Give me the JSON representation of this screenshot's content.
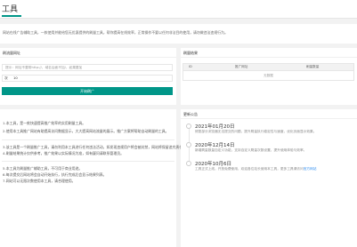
{
  "app": {
    "title": "工具"
  },
  "intro": "网站在线广告辅助工具，一款使用并能给您无优惠提供的刷量工具，帮你提高在线效率，正常操作不要以任何非法目的使用，请勿做违法违规行为。",
  "form": {
    "card_title": "刷流量网址",
    "url_placeholder": "提示：网址不要带http://，域名后面不加/，如果要加",
    "count_prefix": "次",
    "count_value": "10",
    "submit_label": "开始刷广"
  },
  "results": {
    "card_title": "刷量结果",
    "columns": [
      "ID",
      "推广网址",
      "刷量数量"
    ],
    "empty_text": "无数据"
  },
  "tips": [
    "1.本工具，是一款快速提高推广效率的实用刷量工具。",
    "2.使用本工具推广网站有助提高访问数据显示，大大提高网站流量的展示。推广方案将帮助自动刷量的工具。",
    "3.该工具是一个刷量推广工具，请勿利用本工具进行任何违法活动，如发现违规用户将会被封禁，网站将保留追究责任的权利。",
    "4.刷量结果统计仅供参考，推广效果以实际情况为准，如有疑问请联系管理员。",
    "5.本工具为刷量推广辅助工具，不可用于商业用途。",
    "6.每次提交后网站将会自动开始执行，执行完成后会显示结果列表。",
    "7.网站可以无限次数使用本工具，请合理使用。"
  ],
  "log": {
    "card_title": "更新公告",
    "entries": [
      {
        "date": "2021年01月20日",
        "text": "修复部分浏览器无法提交的问题，提升刷量执行稳定性与速度，优化页面显示效果。",
        "link": ""
      },
      {
        "date": "2020年12月14日",
        "text": "新增刷量数量自定义功能，支持自定义刷量次数设置，提升使用体验与效率。",
        "link": ""
      },
      {
        "date": "2020年10月6日",
        "text": "工具正式上线，开放免费使用，欢迎各位站长使用本工具，更多工具请访问",
        "link": "官方网站"
      }
    ]
  }
}
